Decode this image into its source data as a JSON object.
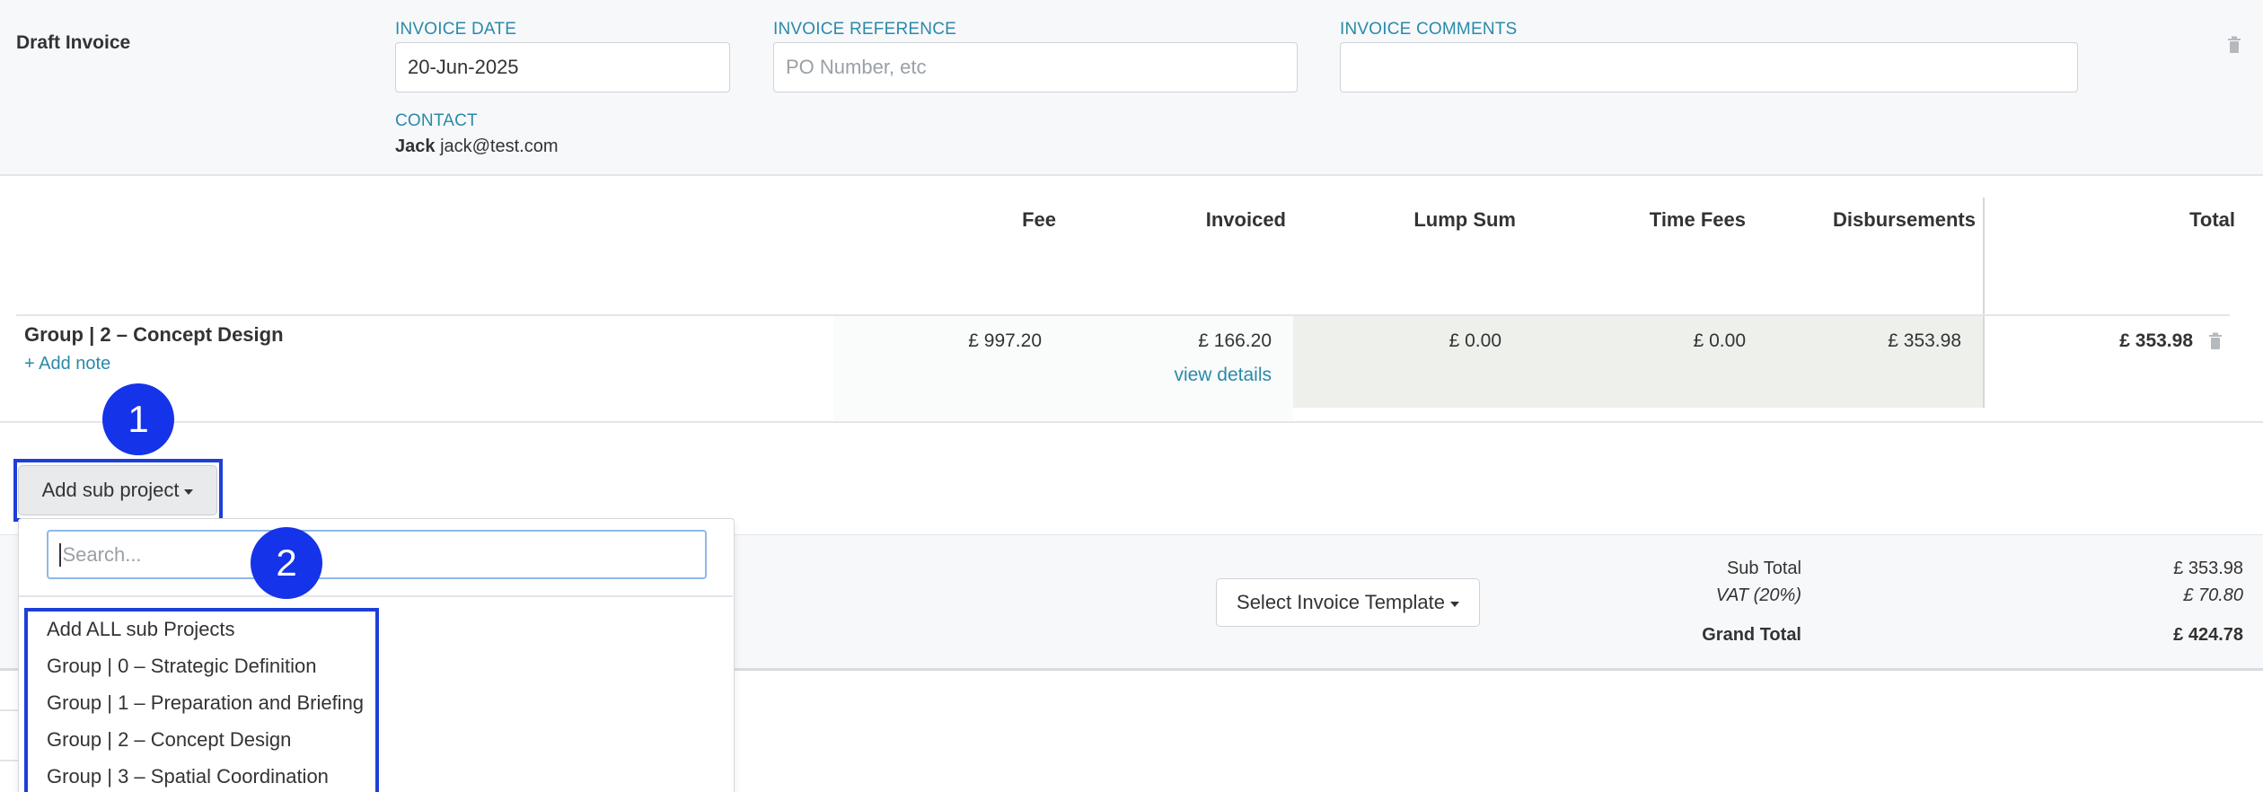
{
  "header": {
    "title": "Draft Invoice",
    "invoice_date_label": "INVOICE DATE",
    "invoice_date_value": "20-Jun-2025",
    "invoice_reference_label": "INVOICE REFERENCE",
    "invoice_reference_placeholder": "PO Number, etc",
    "invoice_comments_label": "INVOICE COMMENTS",
    "invoice_comments_value": "",
    "contact_label": "CONTACT",
    "contact_name": "Jack",
    "contact_email": "jack@test.com"
  },
  "table": {
    "columns": [
      "Fee",
      "Invoiced",
      "Lump Sum",
      "Time Fees",
      "Disbursements",
      "Total"
    ],
    "rows": [
      {
        "name": "Group | 2 – Concept Design",
        "add_note": "+ Add note",
        "fee": "£ 997.20",
        "invoiced": "£ 166.20",
        "view_details": "view details",
        "lump_sum": "£ 0.00",
        "time_fees": "£ 0.00",
        "disbursements": "£ 353.98",
        "total": "£ 353.98"
      }
    ]
  },
  "add_sub_project": {
    "button_label": "Add sub project",
    "search_placeholder": "Search...",
    "options": [
      "Add ALL sub Projects",
      "Group | 0 – Strategic Definition",
      "Group | 1 – Preparation and Briefing",
      "Group | 2 – Concept Design",
      "Group | 3 – Spatial Coordination"
    ]
  },
  "footer": {
    "template_button_label": "Select Invoice Template",
    "sub_total_label": "Sub Total",
    "sub_total_value": "£ 353.98",
    "vat_label": "VAT (20%)",
    "vat_value": "£ 70.80",
    "grand_total_label": "Grand Total",
    "grand_total_value": "£ 424.78"
  },
  "markers": [
    "1",
    "2"
  ],
  "colors": {
    "accent_label": "#2a8aa8",
    "marker": "#1533e8",
    "highlight": "#1d3fd8"
  },
  "icons": [
    "trash-icon",
    "caret-down-icon"
  ]
}
